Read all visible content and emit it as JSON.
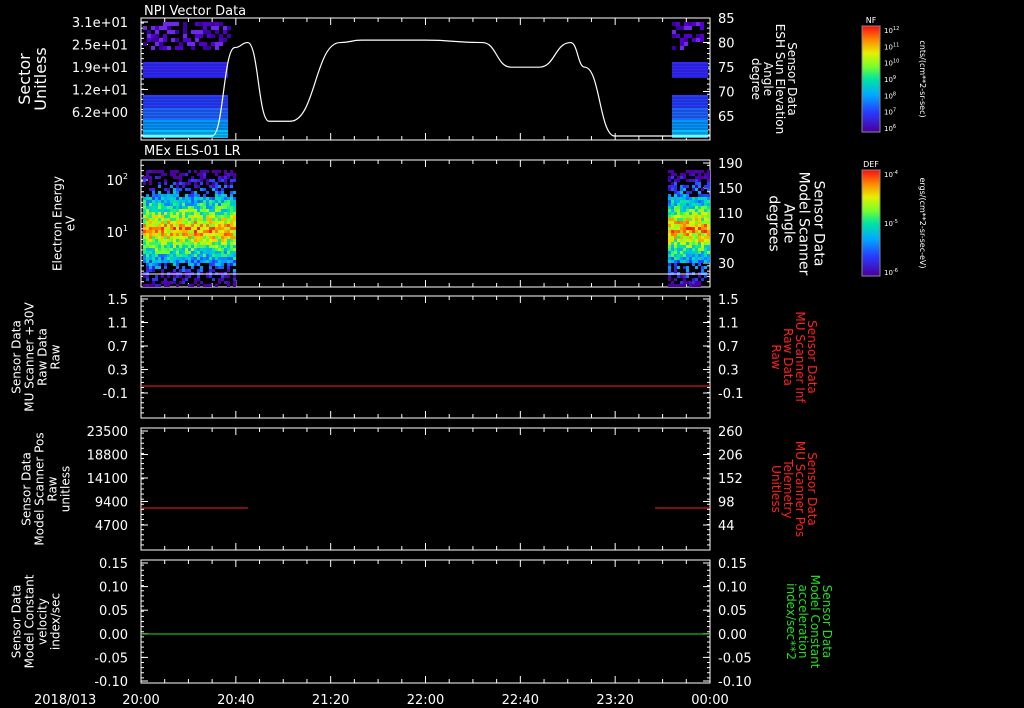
{
  "colors": {
    "background": "#000000",
    "foreground": "#ffffff",
    "red_series": "#ff2020",
    "green_series": "#22dd22"
  },
  "footer": {
    "date_label": "2018/013",
    "time_ticks": [
      "20:00",
      "20:40",
      "21:20",
      "22:00",
      "22:40",
      "23:20",
      "00:00"
    ]
  },
  "panels": [
    {
      "id": "npi",
      "title": "NPI Vector Data",
      "left_label": [
        "Sector",
        "Unitless"
      ],
      "left_ticks": [
        "3.1e+01",
        "2.5e+01",
        "1.9e+01",
        "1.2e+01",
        "6.2e+00"
      ],
      "right_label": [
        "Sensor Data",
        "ESH Sun Elevation",
        "Angle",
        "degree"
      ],
      "right_ticks": [
        "85",
        "80",
        "75",
        "70",
        "65"
      ],
      "colorbar": {
        "label": "NF",
        "unit": "cnts/(cm**2-sr-sec)",
        "tick_mantissa": [
          "10",
          "10",
          "10",
          "10",
          "10",
          "10",
          "10"
        ],
        "tick_exponent": [
          "12",
          "11",
          "10",
          "9",
          "8",
          "7",
          "6"
        ]
      }
    },
    {
      "id": "els",
      "title": "MEx ELS-01 LR",
      "left_label": [
        "Electron Energy",
        "eV"
      ],
      "left_ticks": [
        "10",
        "10"
      ],
      "left_tick_exp": [
        "2",
        "1"
      ],
      "right_label": [
        "Sensor Data",
        "Model Scanner",
        "Angle",
        "degrees"
      ],
      "right_ticks": [
        "190",
        "150",
        "110",
        "70",
        "30"
      ],
      "colorbar": {
        "label": "DEF",
        "unit": "ergs/(cm**2-sr-sec-eV)",
        "tick_mantissa": [
          "10",
          "10",
          "10"
        ],
        "tick_exponent": [
          "-4",
          "-5",
          "-6"
        ]
      }
    },
    {
      "id": "scanner30v",
      "title": "",
      "left_label": [
        "Sensor Data",
        "MU Scanner +30V",
        "Raw Data",
        "Raw"
      ],
      "left_ticks": [
        "1.5",
        "1.1",
        "0.7",
        "0.3",
        "-0.1"
      ],
      "right_label": [
        "Sensor Data",
        "MU Scanner Inf",
        "Raw Data",
        "Raw"
      ],
      "right_ticks": [
        "1.5",
        "1.1",
        "0.7",
        "0.3",
        "-0.1"
      ]
    },
    {
      "id": "scannerpos",
      "title": "",
      "left_label": [
        "Sensor Data",
        "Model Scanner Pos",
        "Raw",
        "unitless"
      ],
      "left_ticks": [
        "23500",
        "18800",
        "14100",
        "9400",
        "4700"
      ],
      "right_label": [
        "Sensor Data",
        "MU Scanner Pos",
        "Telemetry",
        "Unitless"
      ],
      "right_ticks": [
        "260",
        "206",
        "152",
        "98",
        "44"
      ]
    },
    {
      "id": "model",
      "title": "",
      "left_label": [
        "Sensor Data",
        "Model Constant",
        "velocity",
        "index/sec"
      ],
      "left_ticks": [
        "0.15",
        "0.10",
        "0.05",
        "0.00",
        "-0.05",
        "-0.10"
      ],
      "right_label": [
        "Sensor Data",
        "Model Constant",
        "acceleration",
        "index/sec**2"
      ],
      "right_ticks": [
        "0.15",
        "0.10",
        "0.05",
        "0.00",
        "-0.05",
        "-0.10"
      ]
    }
  ],
  "chart_data": [
    {
      "type": "heatmap",
      "title": "NPI Vector Data",
      "x_range": [
        "20:00",
        "00:00"
      ],
      "data_intervals": [
        [
          "20:00",
          "20:40"
        ],
        [
          "23:48",
          "00:00"
        ]
      ],
      "right_series": {
        "type": "line",
        "ylim": [
          61,
          85
        ],
        "x_hours": [
          0,
          0.5,
          0.66,
          0.75,
          0.9,
          1.05,
          1.4,
          1.55,
          2.0,
          2.4,
          2.6,
          2.8,
          3.02,
          3.12,
          3.33,
          4.0
        ],
        "y": [
          61,
          61,
          79,
          80,
          64,
          64,
          80,
          80.5,
          80.5,
          80,
          75,
          75,
          80,
          75,
          61,
          61
        ]
      }
    },
    {
      "type": "heatmap",
      "title": "MEx ELS-01 LR",
      "x_range": [
        "20:00",
        "00:00"
      ],
      "data_intervals": [
        [
          "20:00",
          "20:40"
        ],
        [
          "23:48",
          "00:00"
        ]
      ],
      "peak_energy_eV": 10
    },
    {
      "type": "line",
      "ylim": [
        -0.3,
        1.5
      ],
      "series": [
        {
          "x_hours": [
            0,
            4
          ],
          "y": [
            -0.05,
            -0.05
          ]
        }
      ]
    },
    {
      "type": "line",
      "ylim": [
        0,
        23500
      ],
      "series": [
        {
          "x_hours": [
            0,
            0.72
          ],
          "y": [
            8000,
            8000
          ]
        },
        {
          "x_hours": [
            3.58,
            4
          ],
          "y": [
            8000,
            8000
          ]
        }
      ]
    },
    {
      "type": "line",
      "ylim": [
        -0.1,
        0.15
      ],
      "series": [
        {
          "x_hours": [
            0,
            4
          ],
          "y": [
            0,
            0
          ]
        }
      ]
    }
  ]
}
